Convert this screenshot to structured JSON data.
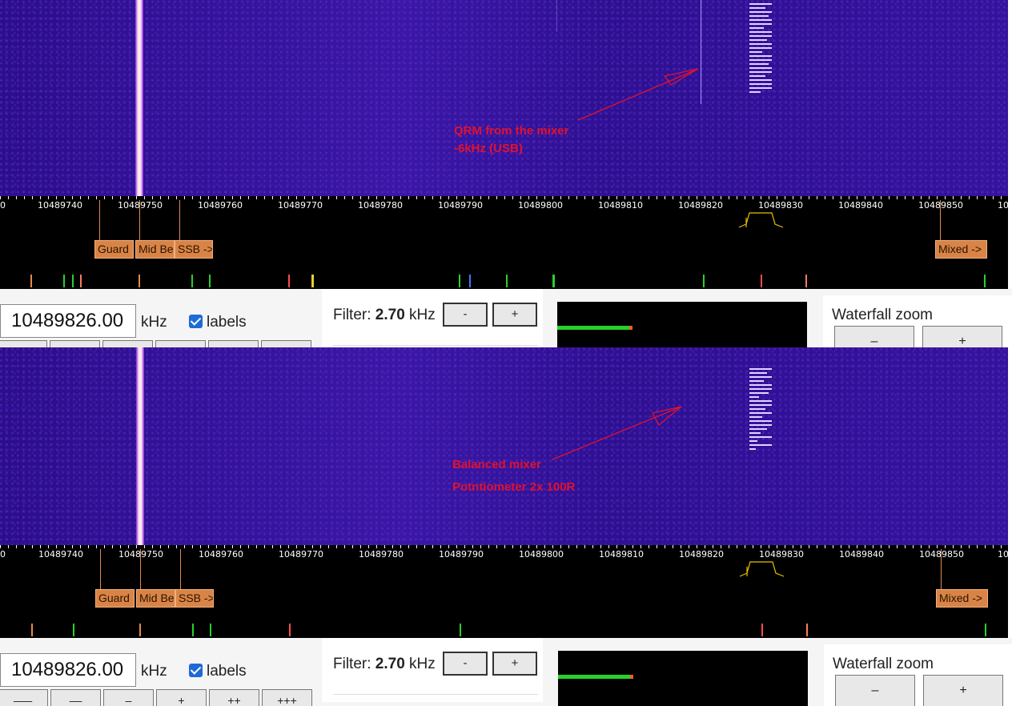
{
  "panels": [
    {
      "annotation": [
        "QRM from the mixer",
        "-6kHz (USB)"
      ],
      "frequency_value": "10489826.00",
      "frequency_unit": "kHz",
      "labels_checkbox": "labels",
      "filter_label": "Filter:",
      "filter_value": "2.70",
      "filter_unit": "kHz",
      "filter_minus": "-",
      "filter_plus": "+",
      "zoom_label": "Waterfall zoom",
      "zoom_minus": "–",
      "zoom_plus": "+",
      "step_buttons": [
        "",
        "",
        "",
        "",
        "",
        ""
      ]
    },
    {
      "annotation": [
        "Balanced mixer",
        "Potntiometer 2x 100R"
      ],
      "frequency_value": "10489826.00",
      "frequency_unit": "kHz",
      "labels_checkbox": "labels",
      "filter_label": "Filter:",
      "filter_value": "2.70",
      "filter_unit": "kHz",
      "filter_minus": "-",
      "filter_plus": "+",
      "zoom_label": "Waterfall zoom",
      "zoom_minus": "–",
      "zoom_plus": "+",
      "step_buttons": [
        "–––",
        "––",
        "–",
        "+",
        "++",
        "+++"
      ]
    }
  ],
  "scale": {
    "tick_labels": [
      "10489740",
      "10489750",
      "10489760",
      "10489770",
      "10489780",
      "10489790",
      "10489800",
      "10489810",
      "10489820",
      "10489830",
      "10489840",
      "10489850"
    ],
    "edge_left": "0",
    "edge_right": "10"
  },
  "band_markers": [
    "Guard",
    "Mid Be",
    "SSB ->",
    "Mixed ->"
  ],
  "colors": {
    "waterfall_bg": "#2a0f8c",
    "annotation": "#e0122e",
    "marker": "#d98446",
    "passband": "#e8c200",
    "smeter_bar": "#27d12b"
  }
}
